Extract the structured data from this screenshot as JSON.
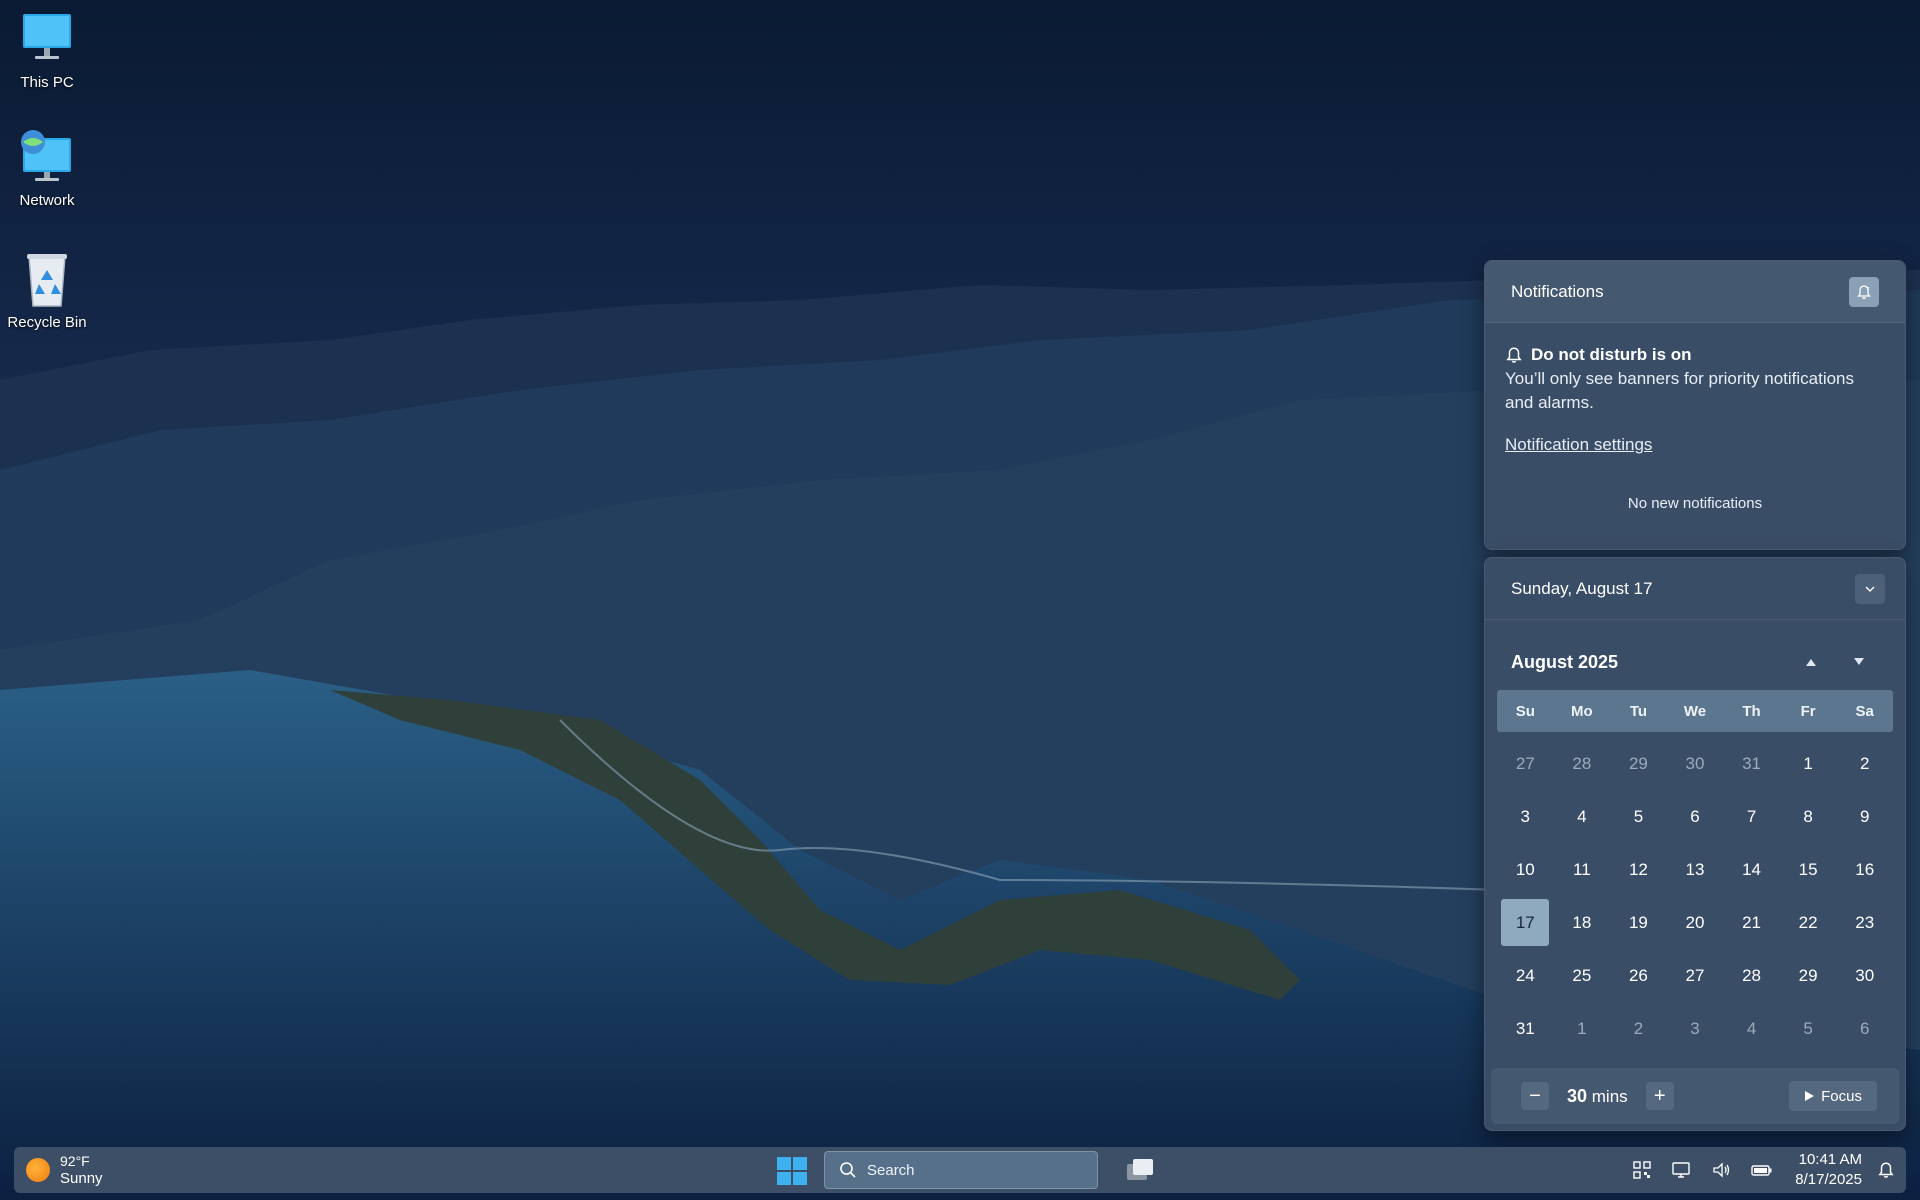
{
  "desktop": {
    "icons": [
      {
        "label": "This PC",
        "icon": "this-pc-icon"
      },
      {
        "label": "Network",
        "icon": "network-icon"
      },
      {
        "label": "Recycle Bin",
        "icon": "recycle-bin-icon"
      }
    ]
  },
  "notifications": {
    "title": "Notifications",
    "dnd_title": "Do not disturb is on",
    "dnd_text": "You’ll only see banners for priority notifications and alarms.",
    "settings_link": "Notification settings",
    "empty_text": "No new notifications"
  },
  "calendar": {
    "date_header": "Sunday, August 17",
    "month_label": "August 2025",
    "weekdays": [
      "Su",
      "Mo",
      "Tu",
      "We",
      "Th",
      "Fr",
      "Sa"
    ],
    "today": 17,
    "days": [
      {
        "day": "27",
        "muted": true
      },
      {
        "day": "28",
        "muted": true
      },
      {
        "day": "29",
        "muted": true
      },
      {
        "day": "30",
        "muted": true
      },
      {
        "day": "31",
        "muted": true
      },
      {
        "day": "1"
      },
      {
        "day": "2"
      },
      {
        "day": "3"
      },
      {
        "day": "4"
      },
      {
        "day": "5"
      },
      {
        "day": "6"
      },
      {
        "day": "7"
      },
      {
        "day": "8"
      },
      {
        "day": "9"
      },
      {
        "day": "10"
      },
      {
        "day": "11"
      },
      {
        "day": "12"
      },
      {
        "day": "13"
      },
      {
        "day": "14"
      },
      {
        "day": "15"
      },
      {
        "day": "16"
      },
      {
        "day": "17",
        "today": true
      },
      {
        "day": "18"
      },
      {
        "day": "19"
      },
      {
        "day": "20"
      },
      {
        "day": "21"
      },
      {
        "day": "22"
      },
      {
        "day": "23"
      },
      {
        "day": "24"
      },
      {
        "day": "25"
      },
      {
        "day": "26"
      },
      {
        "day": "27"
      },
      {
        "day": "28"
      },
      {
        "day": "29"
      },
      {
        "day": "30"
      },
      {
        "day": "31"
      },
      {
        "day": "1",
        "muted": true
      },
      {
        "day": "2",
        "muted": true
      },
      {
        "day": "3",
        "muted": true
      },
      {
        "day": "4",
        "muted": true
      },
      {
        "day": "5",
        "muted": true
      },
      {
        "day": "6",
        "muted": true
      }
    ],
    "focus": {
      "minus": "−",
      "plus": "+",
      "minutes": "30",
      "unit": "mins",
      "button": "Focus"
    }
  },
  "taskbar": {
    "weather_temp": "92°F",
    "weather_cond": "Sunny",
    "search_placeholder": "Search",
    "time": "10:41 AM",
    "date": "8/17/2025",
    "tray_icons": [
      "qr-code-icon",
      "network-monitor-icon",
      "volume-icon",
      "battery-icon",
      "dnd-bell-icon"
    ]
  },
  "colors": {
    "panel": "#3a4d66",
    "panel_header": "#44586f",
    "weekday_bar": "#5d7690",
    "today_highlight": "#8fa9bf",
    "taskbar": "#3d4f66"
  }
}
